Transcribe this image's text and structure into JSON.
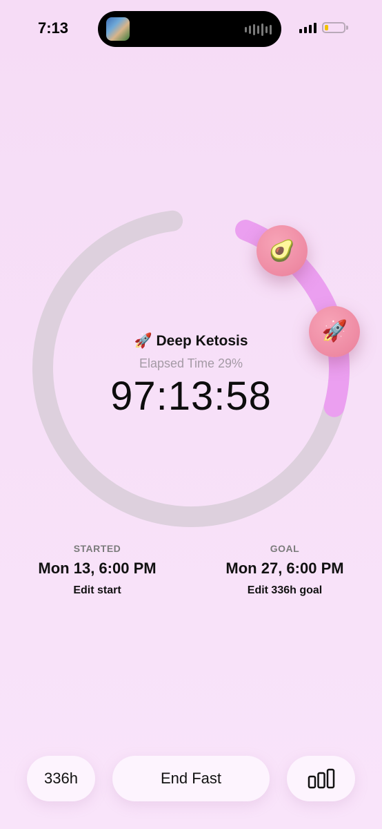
{
  "status_bar": {
    "time": "7:13",
    "battery_level_percent": 20,
    "battery_color": "#f0c200"
  },
  "fast": {
    "stage_icon": "rocket",
    "stage_emoji": "🚀",
    "stage_name": "Deep Ketosis",
    "elapsed_label": "Elapsed Time 29%",
    "elapsed_percent": 29,
    "timer": "97:13:58"
  },
  "markers": [
    {
      "icon": "avocado",
      "emoji": "🥑"
    },
    {
      "icon": "rocket",
      "emoji": "🚀"
    }
  ],
  "started": {
    "label": "STARTED",
    "value": "Mon 13, 6:00 PM",
    "edit": "Edit start"
  },
  "goal": {
    "label": "GOAL",
    "value": "Mon 27, 6:00 PM",
    "edit": "Edit 336h goal"
  },
  "bottom": {
    "duration_button": "336h",
    "end_button": "End Fast",
    "stats_icon": "bar-chart-icon"
  },
  "colors": {
    "ring_track": "#ddd0dd",
    "ring_progress": "#eb9ff0",
    "marker": "#ef8fa8"
  }
}
